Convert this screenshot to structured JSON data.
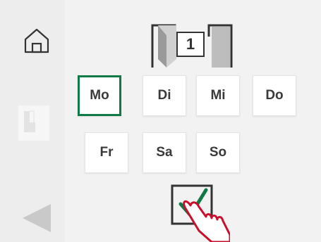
{
  "sidebar": {
    "home_icon": "home-icon",
    "door_icon": "door-icon",
    "back_icon": "back-arrow-icon"
  },
  "door": {
    "icon": "door-open-icon",
    "number": "1"
  },
  "days": {
    "selected": "Mo",
    "row1": [
      "Mo",
      "Di",
      "Mi",
      "Do"
    ],
    "row2": [
      "Fr",
      "Sa",
      "So"
    ]
  },
  "confirm": {
    "icon": "checkbox-check-icon",
    "pointer_icon": "hand-pointer-icon"
  },
  "colors": {
    "accent": "#0f7a45",
    "pointer": "#c8102e"
  }
}
